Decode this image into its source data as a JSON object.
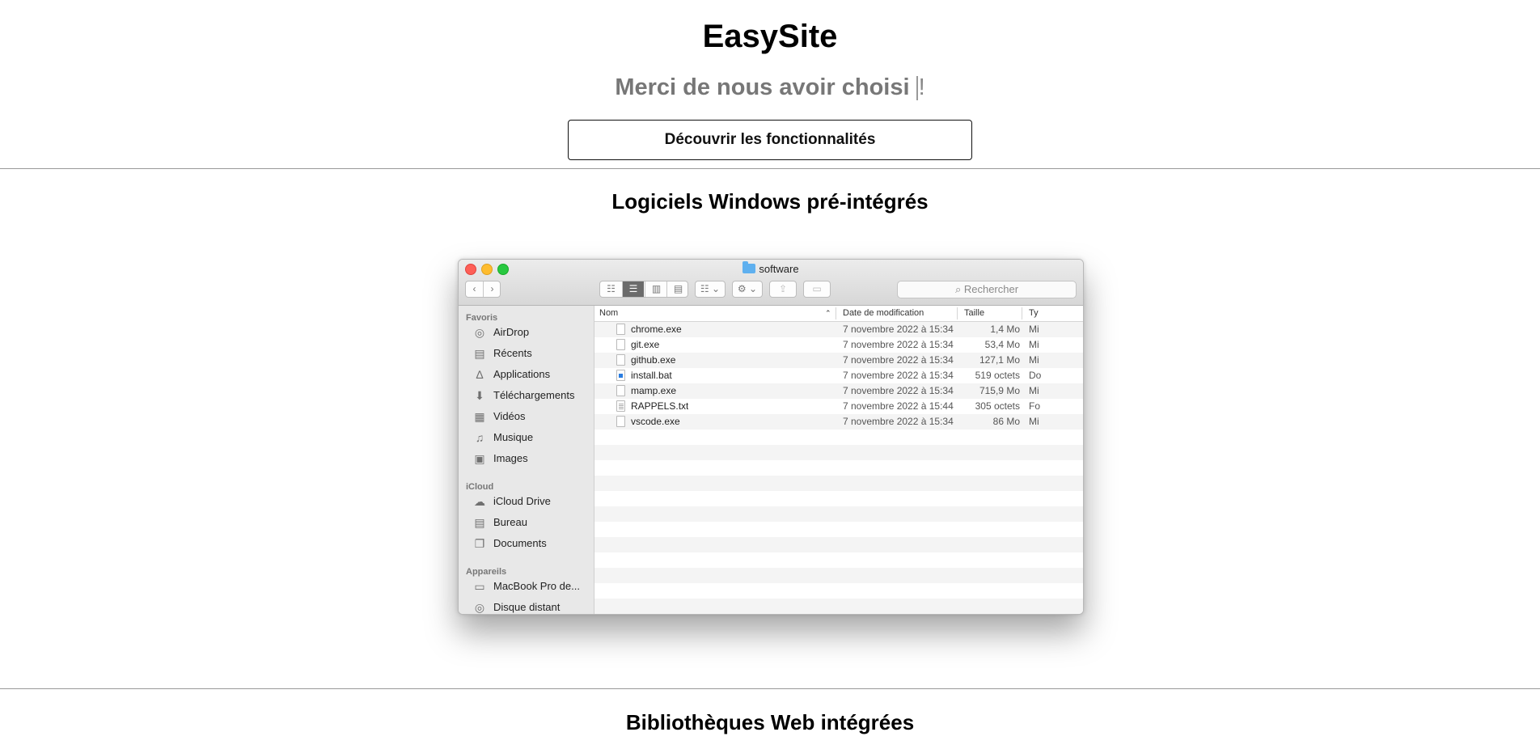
{
  "hero": {
    "title": "EasySite",
    "tagline": "Merci de nous avoir choisi ",
    "tagline_end": "!",
    "cta_label": "Découvrir les fonctionnalités"
  },
  "sections": {
    "software_title": "Logiciels Windows pré-intégrés",
    "libraries_title": "Bibliothèques Web intégrées"
  },
  "finder": {
    "window_title": "software",
    "search_placeholder": "Rechercher",
    "sidebar": {
      "favorites_heading": "Favoris",
      "favorites": [
        {
          "label": "AirDrop",
          "icon": "airdrop-icon"
        },
        {
          "label": "Récents",
          "icon": "recents-icon"
        },
        {
          "label": "Applications",
          "icon": "applications-icon"
        },
        {
          "label": "Téléchargements",
          "icon": "downloads-icon"
        },
        {
          "label": "Vidéos",
          "icon": "videos-icon"
        },
        {
          "label": "Musique",
          "icon": "music-icon"
        },
        {
          "label": "Images",
          "icon": "camera-icon"
        }
      ],
      "icloud_heading": "iCloud",
      "icloud": [
        {
          "label": "iCloud Drive",
          "icon": "cloud-icon"
        },
        {
          "label": "Bureau",
          "icon": "desktop-icon"
        },
        {
          "label": "Documents",
          "icon": "documents-icon"
        }
      ],
      "devices_heading": "Appareils",
      "devices": [
        {
          "label": "MacBook Pro de...",
          "icon": "laptop-icon"
        },
        {
          "label": "Disque distant",
          "icon": "disc-icon"
        }
      ]
    },
    "columns": {
      "name": "Nom",
      "modified": "Date de modification",
      "size": "Taille",
      "kind": "Ty"
    },
    "files": [
      {
        "name": "chrome.exe",
        "modified": "7 novembre 2022 à 15:34",
        "size": "1,4 Mo",
        "kind": "Mi",
        "icon": "file-icon"
      },
      {
        "name": "git.exe",
        "modified": "7 novembre 2022 à 15:34",
        "size": "53,4 Mo",
        "kind": "Mi",
        "icon": "file-icon"
      },
      {
        "name": "github.exe",
        "modified": "7 novembre 2022 à 15:34",
        "size": "127,1 Mo",
        "kind": "Mi",
        "icon": "file-icon"
      },
      {
        "name": "install.bat",
        "modified": "7 novembre 2022 à 15:34",
        "size": "519 octets",
        "kind": "Do",
        "icon": "bat-file-icon"
      },
      {
        "name": "mamp.exe",
        "modified": "7 novembre 2022 à 15:34",
        "size": "715,9 Mo",
        "kind": "Mi",
        "icon": "file-icon"
      },
      {
        "name": "RAPPELS.txt",
        "modified": "7 novembre 2022 à 15:44",
        "size": "305 octets",
        "kind": "Fo",
        "icon": "text-file-icon"
      },
      {
        "name": "vscode.exe",
        "modified": "7 novembre 2022 à 15:34",
        "size": "86 Mo",
        "kind": "Mi",
        "icon": "file-icon"
      }
    ]
  }
}
